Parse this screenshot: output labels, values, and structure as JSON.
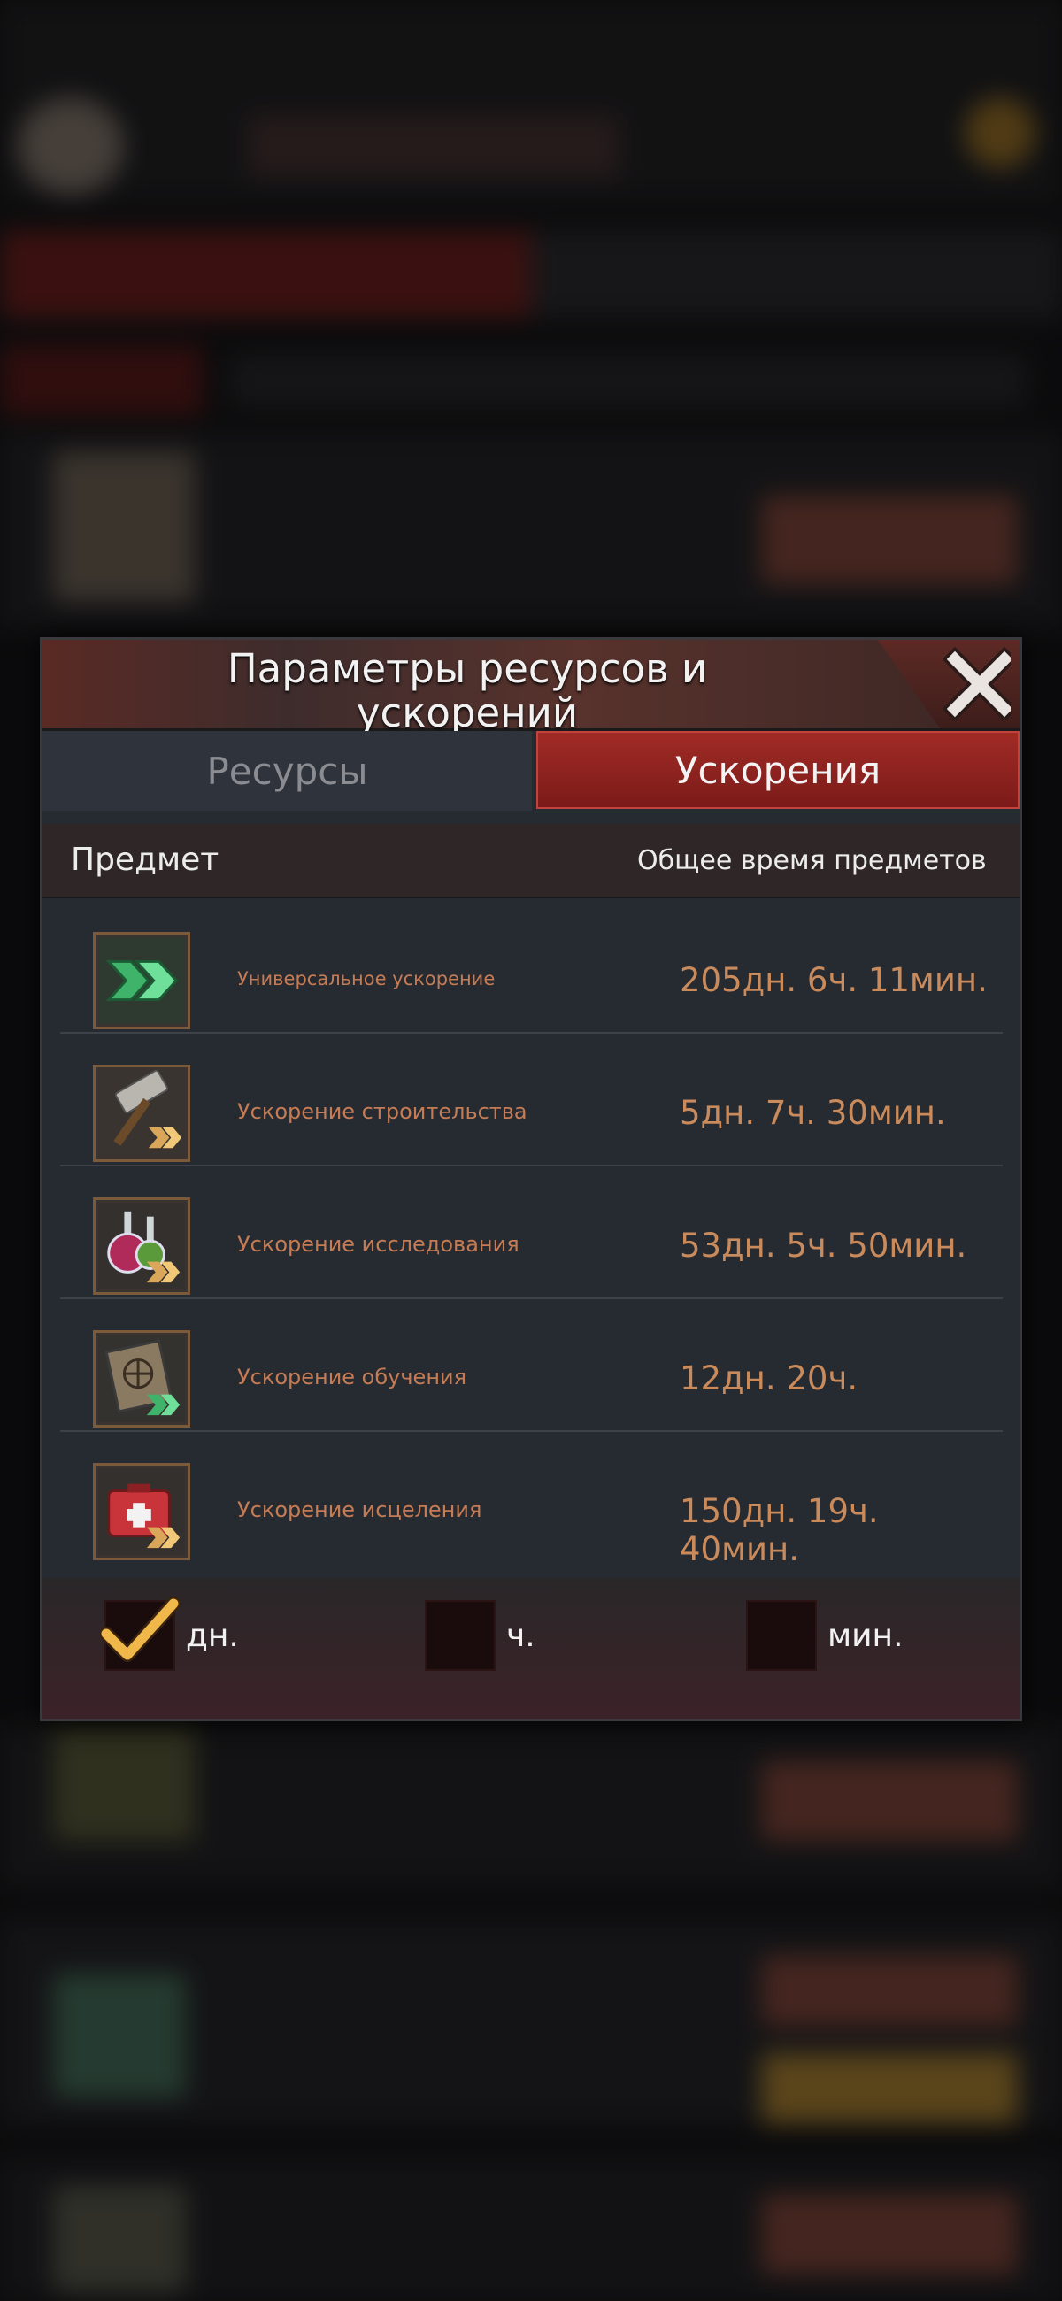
{
  "dialog": {
    "title": "Параметры ресурсов и ускорений",
    "tabs": [
      {
        "label": "Ресурсы",
        "active": false
      },
      {
        "label": "Ускорения",
        "active": true
      }
    ],
    "columns": {
      "item": "Предмет",
      "total_time": "Общее время предметов"
    },
    "rows": [
      {
        "icon": "universal-speedup-icon",
        "label": "Универсальное ускорение",
        "time": "205дн. 6ч. 11мин."
      },
      {
        "icon": "construction-speedup-icon",
        "label": "Ускорение строительства",
        "time": "5дн. 7ч. 30мин."
      },
      {
        "icon": "research-speedup-icon",
        "label": "Ускорение исследования",
        "time": "53дн. 5ч. 50мин."
      },
      {
        "icon": "training-speedup-icon",
        "label": "Ускорение обучения",
        "time": "12дн. 20ч."
      },
      {
        "icon": "healing-speedup-icon",
        "label": "Ускорение исцеления",
        "time": "150дн. 19ч. 40мин."
      }
    ],
    "units": [
      {
        "label": "дн.",
        "checked": true
      },
      {
        "label": "ч.",
        "checked": false
      },
      {
        "label": "мин.",
        "checked": false
      }
    ]
  },
  "colors": {
    "accent_red": "#a12b26",
    "time_text": "#c98a5c",
    "check": "#f0b84a"
  }
}
